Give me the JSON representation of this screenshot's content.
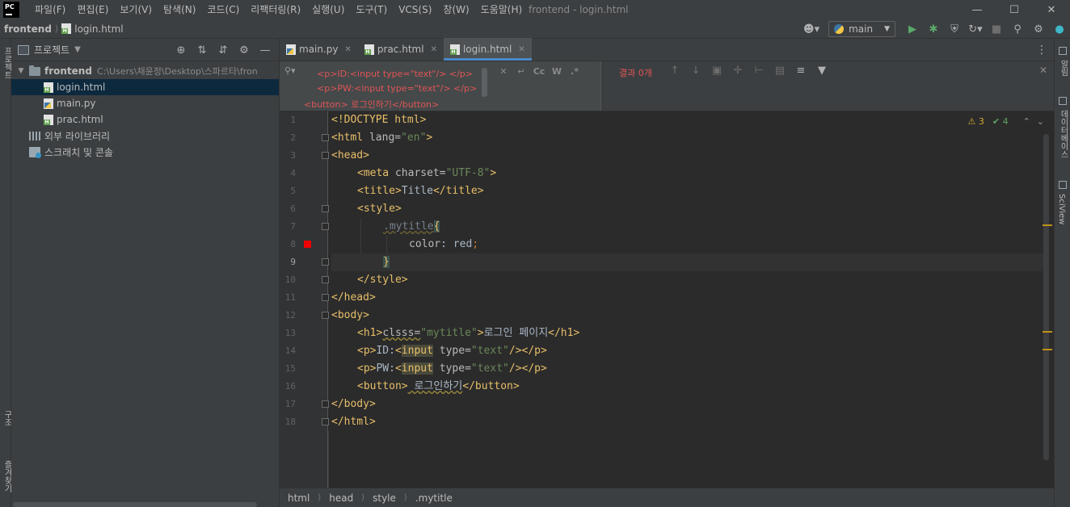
{
  "menubar": {
    "logo": "PC",
    "items": [
      "파일(F)",
      "편집(E)",
      "보기(V)",
      "탐색(N)",
      "코드(C)",
      "리팩터링(R)",
      "실행(U)",
      "도구(T)",
      "VCS(S)",
      "창(W)",
      "도움말(H)"
    ],
    "window_title": "frontend - login.html"
  },
  "navbar": {
    "project": "frontend",
    "file": "login.html",
    "run_config": "main"
  },
  "left_strip": {
    "labels": [
      "프로젝트",
      "구조",
      "즐겨찾기"
    ]
  },
  "project_panel": {
    "title": "프로젝트",
    "tree": [
      {
        "name": "frontend",
        "path": "C:\\Users\\채윤정\\Desktop\\스파르타\\fron",
        "type": "folder",
        "expanded": true
      },
      {
        "name": "login.html",
        "type": "html",
        "selected": true
      },
      {
        "name": "main.py",
        "type": "python"
      },
      {
        "name": "prac.html",
        "type": "html"
      },
      {
        "name": "외부 라이브러리",
        "type": "library"
      },
      {
        "name": "스크래치 및 콘솔",
        "type": "scratch"
      }
    ]
  },
  "tabs": [
    {
      "label": "main.py",
      "type": "python",
      "active": false
    },
    {
      "label": "prac.html",
      "type": "html",
      "active": false
    },
    {
      "label": "login.html",
      "type": "html",
      "active": true
    }
  ],
  "find": {
    "lines": [
      "<p>ID:<input type=\"text\"/> </p>",
      "<p>PW:<input type=\"text\"/> </p>",
      "<button> 로그인하기</button>"
    ],
    "options": [
      "Cc",
      "W",
      ".*"
    ],
    "match_count": "결과 0개"
  },
  "inspections": {
    "warnings": "3",
    "weak_warnings": "4"
  },
  "code": {
    "line_numbers": [
      "1",
      "2",
      "3",
      "4",
      "5",
      "6",
      "7",
      "8",
      "9",
      "10",
      "11",
      "12",
      "13",
      "14",
      "15",
      "16",
      "17",
      "18"
    ],
    "l1": "<!DOCTYPE html>",
    "l2_tag": "<html ",
    "l2_attr": "lang=",
    "l2_val": "\"en\"",
    "l2_end": ">",
    "l3": "<head>",
    "l4_tag": "<meta ",
    "l4_attr": "charset=",
    "l4_val": "\"UTF-8\"",
    "l4_end": ">",
    "l5_open": "<title>",
    "l5_text": "Title",
    "l5_close": "</title>",
    "l6": "<style>",
    "l7_sel": ".mytitle",
    "l7_brace": "{",
    "l8_prop": "color",
    "l8_colon": ": ",
    "l8_val": "red",
    "l8_semi": ";",
    "l9": "}",
    "l10": "</style>",
    "l11": "</head>",
    "l12": "<body>",
    "l13_open": "<h1>",
    "l13_attr": "clsss=",
    "l13_val": "\"mytitle\"",
    "l13_gt": ">",
    "l13_text": "로그인 페이지",
    "l13_close": "</h1>",
    "l14_open": "<p>",
    "l14_text": "ID:",
    "l14_lt": "<",
    "l14_input": "input",
    "l14_attr": " type=",
    "l14_val": "\"text\"",
    "l14_end": "/></p>",
    "l15_open": "<p>",
    "l15_text": "PW:",
    "l15_lt": "<",
    "l15_input": "input",
    "l15_attr": " type=",
    "l15_val": "\"text\"",
    "l15_end": "/></p>",
    "l16_open": "<button>",
    "l16_text": " 로그인하기",
    "l16_close": "</button>",
    "l17": "</body>",
    "l18": "</html>"
  },
  "status_bar": {
    "crumbs": [
      "html",
      "head",
      "style",
      ".mytitle"
    ]
  },
  "right_strip": {
    "labels": [
      "알림",
      "데이터베이스",
      "SciView"
    ]
  },
  "colors": {
    "background": "#2b2b2b",
    "panel": "#3c3f41",
    "tag": "#e8bf6a",
    "string": "#6a8759",
    "selection": "#0d293e",
    "accent": "#4a88c7",
    "error": "#e05555"
  }
}
